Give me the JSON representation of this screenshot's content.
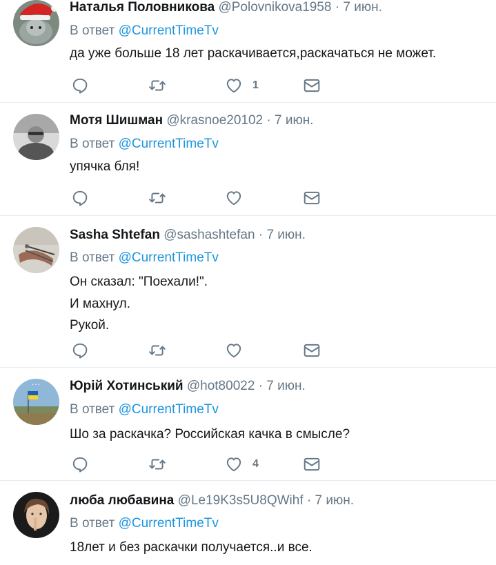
{
  "reply_prefix": "В ответ",
  "separator": "·",
  "tweets": [
    {
      "name": "Наталья Половникова",
      "handle": "@Polovnikova1958",
      "time": "7 июн.",
      "reply_to": "@CurrentTimeTv",
      "lines": [
        "да уже больше 18 лет раскачивается,раскачаться не может."
      ],
      "like_count": "1"
    },
    {
      "name": "Мотя Шишман",
      "handle": "@krasnoe20102",
      "time": "7 июн.",
      "reply_to": "@CurrentTimeTv",
      "lines": [
        "упячка бля!"
      ],
      "like_count": ""
    },
    {
      "name": "Sasha Shtefan",
      "handle": "@sashashtefan",
      "time": "7 июн.",
      "reply_to": "@CurrentTimeTv",
      "lines": [
        "Он сказал: \"Поехали!\".",
        "И махнул.",
        "Рукой."
      ],
      "like_count": ""
    },
    {
      "name": "Юрій Хотинський",
      "handle": "@hot80022",
      "time": "7 июн.",
      "reply_to": "@CurrentTimeTv",
      "lines": [
        "Шо за раскачка? Российская качка в смысле?"
      ],
      "like_count": "4"
    },
    {
      "name": "люба любавина",
      "handle": "@Le19K3s5U8QWihf",
      "time": "7 июн.",
      "reply_to": "@CurrentTimeTv",
      "lines": [
        "18лет и без раскачки получается..и все."
      ],
      "like_count": ""
    }
  ],
  "icons": {
    "reply": "reply-icon",
    "retweet": "retweet-icon",
    "like": "heart-icon",
    "message": "envelope-icon"
  },
  "colors": {
    "name": "#14171a",
    "meta": "#657786",
    "mention": "#1b95e0",
    "divider": "#e6ecf0"
  }
}
